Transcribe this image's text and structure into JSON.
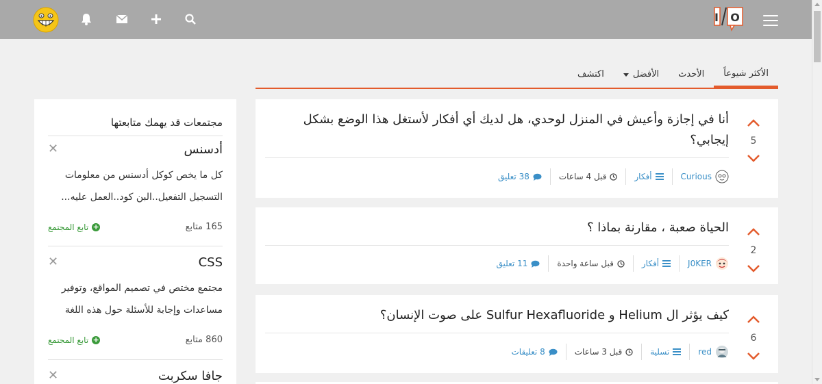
{
  "logo": {
    "text": "I/O"
  },
  "tabs": [
    {
      "label": "الأكثر شيوعاً"
    },
    {
      "label": "الأحدث"
    },
    {
      "label": "الأفضل"
    },
    {
      "label": "اكتشف"
    }
  ],
  "posts": [
    {
      "title_line1": "أنا في إجازة وأعيش في المنزل لوحدي، هل لديك أي أفكار لأستغل هذا الوضع بشكل",
      "title_line2": "إيجابي؟",
      "votes": "5",
      "author": "Curious",
      "category": "أفكار",
      "time": "قبل 4 ساعات",
      "comments": "38 تعليق"
    },
    {
      "title_line1": "الحياة صعبة ، مقارنة بماذا ؟",
      "votes": "2",
      "author": "J0KER",
      "category": "أفكار",
      "time": "قبل ساعة واحدة",
      "comments": "11 تعليق"
    },
    {
      "title_line1": "كيف يؤثر ال Helium و Sulfur Hexafluoride على صوت الإنسان؟",
      "votes": "6",
      "author": "red",
      "category": "تسلية",
      "time": "قبل 3 ساعات",
      "comments": "8 تعليقات"
    }
  ],
  "sidebar": {
    "title": "مجتمعات قد يهمك متابعتها",
    "communities": [
      {
        "name": "أدسنس",
        "desc_line1": "كل ما يخص كوكل أدسنس من معلومات",
        "desc_line2": "التسجيل التفعيل..البن كود..العمل عليه...",
        "follow": "تابع المجتمع",
        "followers": "165 متابع"
      },
      {
        "name": "CSS",
        "desc_line1": "مجتمع مختص في تصميم المواقع، وتوفير",
        "desc_line2": "مساعدات وإجابة للأسئلة حول هذه اللغة",
        "follow": "تابع المجتمع",
        "followers": "860 متابع"
      },
      {
        "name": "جافا سكربت"
      }
    ]
  },
  "colors": {
    "accent": "#e35b2c",
    "link": "#3a8fc7",
    "follow": "#3a9a3a",
    "header": "#a9a9a9"
  }
}
